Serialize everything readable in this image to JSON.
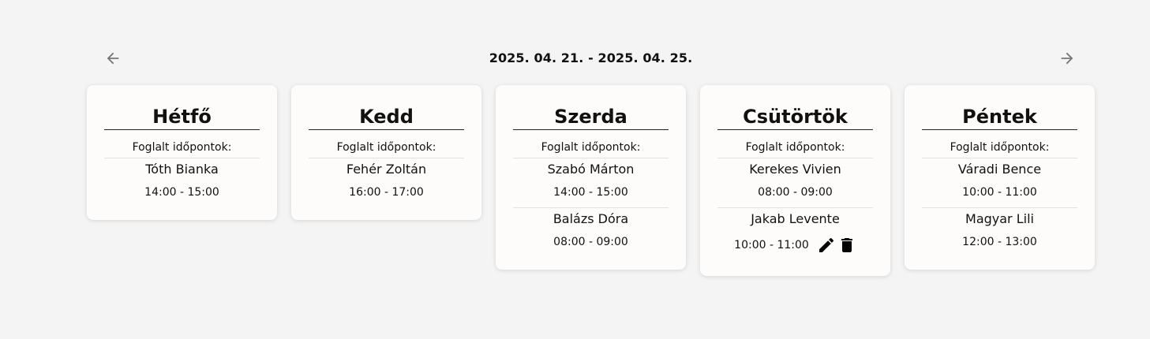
{
  "header": {
    "week_range": "2025. 04. 21. - 2025. 04. 25.",
    "prev_icon": "arrow-left-icon",
    "next_icon": "arrow-right-icon"
  },
  "colors": {
    "background": "#f4f4f4",
    "card": "#fdfcfa",
    "arrow": "#777777"
  },
  "days": [
    {
      "title": "Hétfő",
      "booked_label": "Foglalt időpontok:",
      "appointments": [
        {
          "name": "Tóth Bianka",
          "time": "14:00 - 15:00"
        }
      ]
    },
    {
      "title": "Kedd",
      "booked_label": "Foglalt időpontok:",
      "appointments": [
        {
          "name": "Fehér Zoltán",
          "time": "16:00 - 17:00"
        }
      ]
    },
    {
      "title": "Szerda",
      "booked_label": "Foglalt időpontok:",
      "appointments": [
        {
          "name": "Szabó Márton",
          "time": "14:00 - 15:00"
        },
        {
          "name": "Balázs Dóra",
          "time": "08:00 - 09:00"
        }
      ]
    },
    {
      "title": "Csütörtök",
      "booked_label": "Foglalt időpontok:",
      "appointments": [
        {
          "name": "Kerekes Vivien",
          "time": "08:00 - 09:00"
        },
        {
          "name": "Jakab Levente",
          "time": "10:00 - 11:00",
          "actions": [
            "edit-icon",
            "delete-icon"
          ]
        }
      ]
    },
    {
      "title": "Péntek",
      "booked_label": "Foglalt időpontok:",
      "appointments": [
        {
          "name": "Váradi Bence",
          "time": "10:00 - 11:00"
        },
        {
          "name": "Magyar Lili",
          "time": "12:00 - 13:00"
        }
      ]
    }
  ]
}
